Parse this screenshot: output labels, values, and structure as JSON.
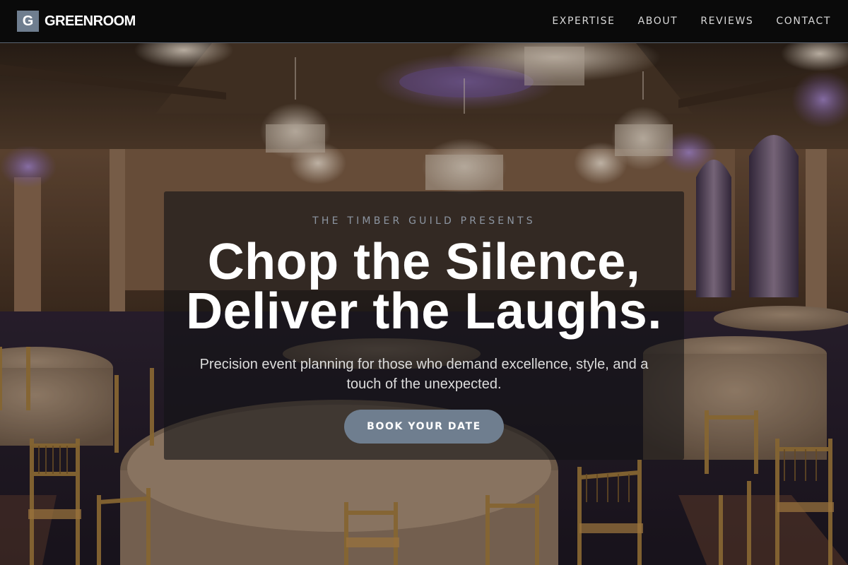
{
  "brand": {
    "mark": "G",
    "name": "GREENROOM"
  },
  "nav": {
    "links": [
      {
        "label": "EXPERTISE"
      },
      {
        "label": "ABOUT"
      },
      {
        "label": "REVIEWS"
      },
      {
        "label": "CONTACT"
      }
    ]
  },
  "hero": {
    "eyebrow": "THE TIMBER GUILD PRESENTS",
    "headline_line1": "Chop the Silence,",
    "headline_line2": "Deliver the Laughs.",
    "subtitle": "Precision event planning for those who demand excellence, style, and a touch of the unexpected.",
    "cta_label": "BOOK YOUR DATE",
    "background_image": "ballroom with chandeliers, round tables with cream tablecloths and gold chiavari chairs"
  },
  "colors": {
    "accent": "#6f7e8f",
    "navbar_bg": "#0a0a0a",
    "eyebrow": "#8c95a1"
  }
}
